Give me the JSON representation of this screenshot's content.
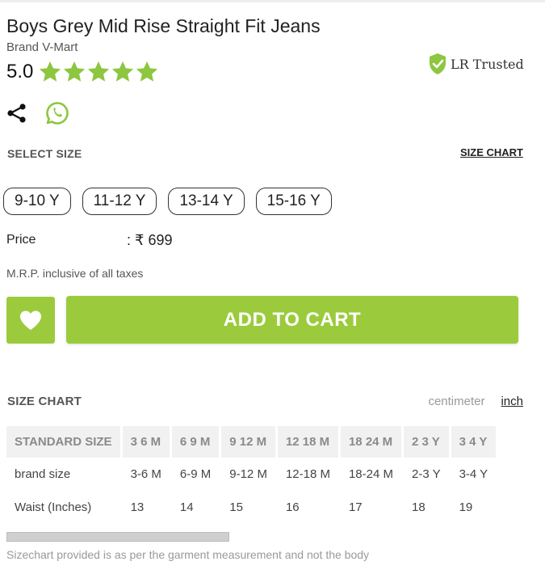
{
  "product": {
    "title": "Boys Grey Mid Rise Straight Fit Jeans",
    "brand": "Brand V-Mart",
    "rating": "5.0",
    "stars": 5,
    "star_color": "#8dc63f"
  },
  "badge": {
    "text": "LR Trusted",
    "icon": "shield-check-icon",
    "color": "#8dc63f"
  },
  "share": {
    "share_icon": "share-icon",
    "whatsapp_icon": "whatsapp-icon",
    "whatsapp_color": "#8dc63f"
  },
  "size_select": {
    "label": "SELECT SIZE",
    "chart_link": "SIZE CHART",
    "options": [
      "9-10 Y",
      "11-12 Y",
      "13-14 Y",
      "15-16 Y"
    ]
  },
  "price": {
    "label": "Price",
    "value": ": ₹ 699",
    "mrp_note": "M.R.P. inclusive of all taxes"
  },
  "actions": {
    "wishlist_icon": "heart-icon",
    "add_to_cart": "ADD TO CART",
    "accent": "#9bcb3c"
  },
  "size_chart": {
    "title": "SIZE CHART",
    "unit_cm": "centimeter",
    "unit_inch": "inch",
    "selected_unit": "inch",
    "headers": [
      "STANDARD SIZE",
      "3 6 M",
      "6 9 M",
      "9 12 M",
      "12 18 M",
      "18 24 M",
      "2 3 Y",
      "3 4 Y"
    ],
    "rows": [
      [
        "brand size",
        "3-6 M",
        "6-9 M",
        "9-12 M",
        "12-18 M",
        "18-24 M",
        "2-3 Y",
        "3-4 Y"
      ],
      [
        "Waist (Inches)",
        "13",
        "14",
        "15",
        "16",
        "17",
        "18",
        "19"
      ]
    ],
    "disclaimer": "Sizechart provided is as per the garment measurement and not the body"
  }
}
